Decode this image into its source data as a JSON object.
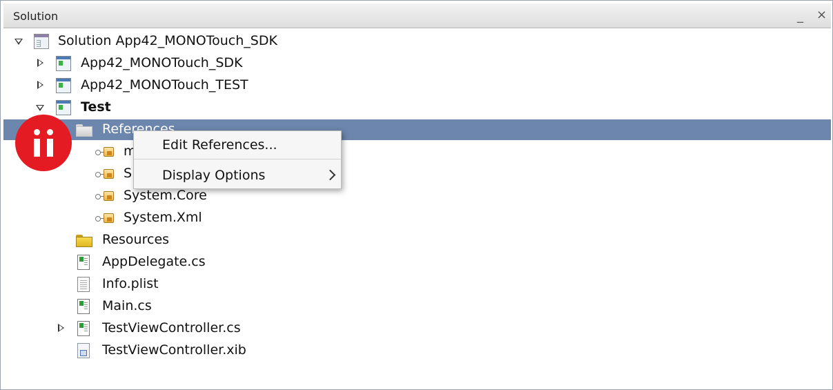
{
  "panel": {
    "title": "Solution",
    "minimize_glyph": "_",
    "close_glyph": "×"
  },
  "tree": {
    "solution": "Solution App42_MONOTouch_SDK",
    "projects": [
      {
        "label": "App42_MONOTouch_SDK"
      },
      {
        "label": "App42_MONOTouch_TEST"
      },
      {
        "label": "Test"
      }
    ],
    "references_folder": "References",
    "references": [
      {
        "label": "m"
      },
      {
        "label": "S"
      },
      {
        "label": "System.Core"
      },
      {
        "label": "System.Xml"
      }
    ],
    "files": [
      {
        "label": "Resources"
      },
      {
        "label": "AppDelegate.cs"
      },
      {
        "label": "Info.plist"
      },
      {
        "label": "Main.cs"
      },
      {
        "label": "TestViewController.cs"
      },
      {
        "label": "TestViewController.xib"
      }
    ]
  },
  "context_menu": {
    "items": [
      {
        "label": "Edit References..."
      },
      {
        "label": "Display Options"
      }
    ]
  },
  "colors": {
    "selection": "#6c86ad",
    "badge": "#e41b23"
  },
  "icons": {
    "solution": "solution-icon",
    "project": "project-icon",
    "folder": "folder-icon",
    "reference": "reference-icon",
    "cs_file": "csharp-file-icon",
    "plist": "plist-file-icon",
    "xib": "xib-file-icon",
    "badge": "ii-logo-icon"
  }
}
